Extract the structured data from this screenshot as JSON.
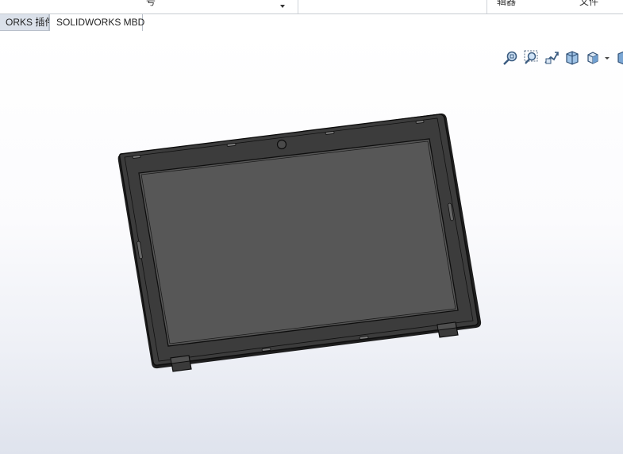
{
  "ribbon": {
    "item1": "号",
    "item2": "辑器",
    "item3": "文件"
  },
  "tabs": [
    {
      "label": "ORKS 插件",
      "active": false
    },
    {
      "label": "SOLIDWORKS MBD",
      "active": true
    }
  ],
  "heads_up_toolbar": {
    "icons": [
      "zoom-to-fit-icon",
      "zoom-to-area-icon",
      "previous-view-icon",
      "section-view-icon",
      "view-orientation-icon",
      "dropdown-arrow-icon",
      "display-style-icon"
    ]
  },
  "model": {
    "description_colors": {
      "body": "#3c3c3c",
      "screen": "#575757",
      "edge": "#111111"
    }
  }
}
